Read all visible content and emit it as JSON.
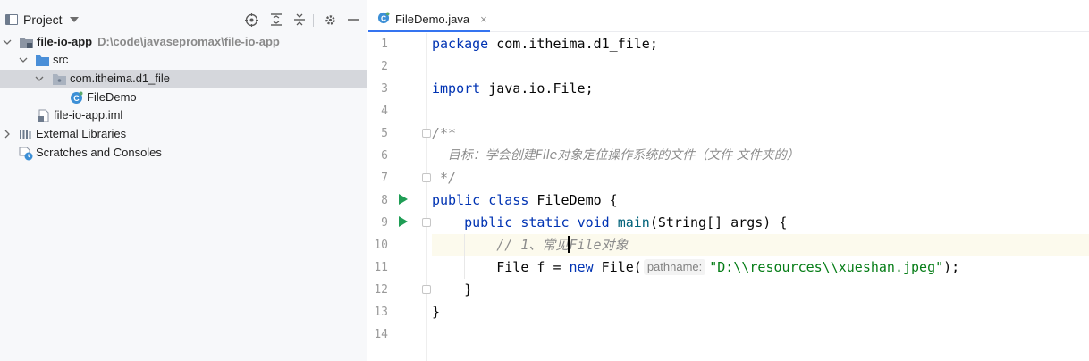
{
  "project_panel": {
    "title": "Project",
    "toolbar_icons": [
      "target-icon",
      "expand-all-icon",
      "collapse-all-icon",
      "gear-icon",
      "minimize-icon"
    ],
    "tree": [
      {
        "label": "file-io-app",
        "path": "D:\\code\\javasepromax\\file-io-app",
        "icon": "module-folder-icon",
        "expanded": true
      },
      {
        "label": "src",
        "icon": "source-folder-icon",
        "expanded": true
      },
      {
        "label": "com.itheima.d1_file",
        "icon": "package-icon",
        "expanded": true,
        "selected": true
      },
      {
        "label": "FileDemo",
        "icon": "java-class-icon"
      },
      {
        "label": "file-io-app.iml",
        "icon": "iml-file-icon"
      },
      {
        "label": "External Libraries",
        "icon": "libraries-icon",
        "expanded": false
      },
      {
        "label": "Scratches and Consoles",
        "icon": "scratches-icon"
      }
    ]
  },
  "editor": {
    "tab": {
      "label": "FileDemo.java",
      "close": "×",
      "icon": "java-class-icon"
    },
    "line_numbers": [
      "1",
      "2",
      "3",
      "4",
      "5",
      "6",
      "7",
      "8",
      "9",
      "10",
      "11",
      "12",
      "13",
      "14"
    ],
    "code": {
      "l1": {
        "kw": "package",
        "rest": " com.itheima.d1_file;"
      },
      "l3": {
        "kw": "import",
        "rest": " java.io.File;"
      },
      "l5": "/**",
      "l6": "    目标：学会创建File对象定位操作系统的文件（文件 文件夹的）",
      "l7": " */",
      "l8": {
        "kw1": "public",
        "kw2": "class",
        "name": "FileDemo",
        "brace": " {"
      },
      "l9": {
        "kw1": "public",
        "kw2": "static",
        "kw3": "void",
        "fn": "main",
        "params": "(String[] args) {"
      },
      "l10": {
        "comment_a": "// 1、常见",
        "comment_b": "File对象"
      },
      "l11": {
        "type": "File f = ",
        "kw": "new",
        "ctor": " File(",
        "hint": "pathname:",
        "str": "\"D:\\\\resources\\\\xueshan.jpeg\"",
        "end": ");"
      },
      "l12": "}",
      "l13": "}"
    }
  },
  "colors": {
    "keyword": "#0033b3",
    "method": "#00627a",
    "string": "#067d17",
    "comment": "#8c8c8c",
    "selection": "#d5d7dc",
    "run_gutter": "#1f9d55"
  }
}
